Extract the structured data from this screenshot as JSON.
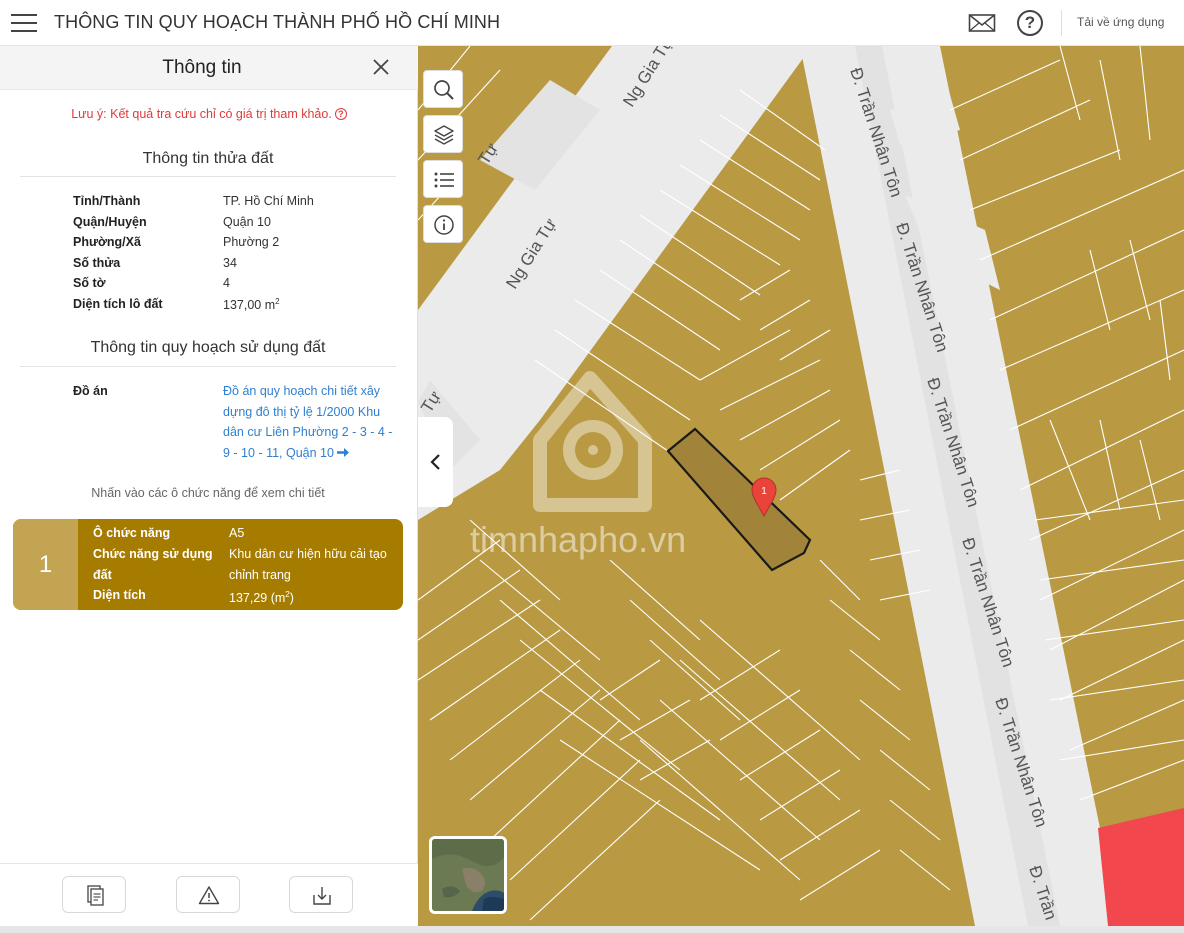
{
  "header": {
    "title": "THÔNG TIN QUY HOẠCH THÀNH PHỐ HỒ CHÍ MINH",
    "download_label": "Tải về ứng dụng"
  },
  "panel": {
    "title": "Thông tin",
    "note": "Lưu ý: Kết quả tra cứu chỉ có giá trị tham khảo.",
    "parcel_section_title": "Thông tin thửa đất",
    "parcel_rows": [
      {
        "label": "Tỉnh/Thành",
        "value": "TP. Hồ Chí Minh"
      },
      {
        "label": "Quận/Huyện",
        "value": "Quận 10"
      },
      {
        "label": "Phường/Xã",
        "value": "Phường 2"
      },
      {
        "label": "Số thửa",
        "value": "34"
      },
      {
        "label": "Số tờ",
        "value": "4"
      },
      {
        "label": "Diện tích lô đất",
        "value": "137,00 m",
        "unit_sup": "2"
      }
    ],
    "planning_section_title": "Thông tin quy hoạch sử dụng đất",
    "plan_label": "Đồ án",
    "plan_link": "Đồ án quy hoạch chi tiết xây dựng đô thị tỷ lệ 1/2000 Khu dân cư Liên Phường 2 - 3 - 4 - 9 - 10 - 11, Quận 10",
    "hint": "Nhấn vào các ô chức năng để xem chi tiết",
    "function_card": {
      "number": "1",
      "cell_label": "Ô chức năng",
      "cell_value": "A5",
      "use_label": "Chức năng sử dụng đất",
      "use_value": "Khu dân cư hiện hữu cải tạo chỉnh trang",
      "area_label": "Diện tích",
      "area_value": "137,29 (m",
      "area_unit_sup": "2",
      "area_close": ")"
    }
  },
  "map": {
    "street_labels": [
      "Ng Gia Tự",
      "Ng Gia Tự",
      "Tự",
      "Tự",
      "Đ. Trần Nhân Tôn",
      "Đ. Trần Nhân Tôn",
      "Đ. Trần Nhân Tôn",
      "Đ. Trần Nhân Tôn",
      "Đ. Trần Nhân Tôn",
      "Đ. Trần"
    ],
    "marker_label": "1",
    "watermark": "timnhapho.vn",
    "colors": {
      "residential": "#b99a43",
      "road": "#ebebeb",
      "parcel_outline": "#ffffff",
      "selected_outline": "#1a1a1a",
      "other_zone": "#f2474d",
      "marker": "#e8443a",
      "card_bg": "#a67c00",
      "card_num_bg": "#c3a453",
      "link": "#2f7fd0",
      "warning_text": "#e03a3a"
    }
  }
}
